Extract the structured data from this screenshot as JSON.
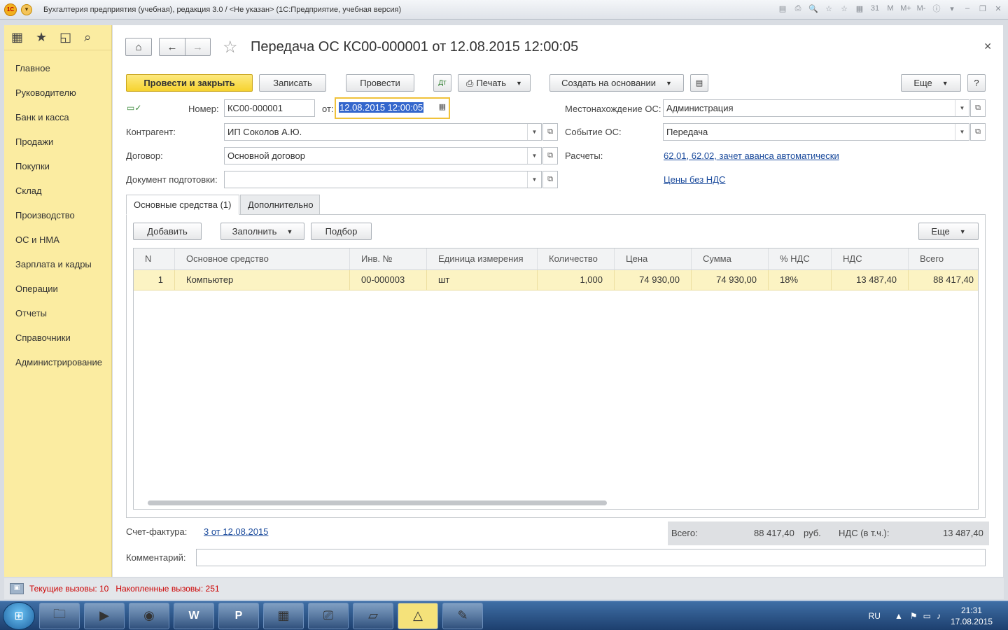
{
  "window": {
    "title": "Бухгалтерия предприятия (учебная), редакция 3.0 / <Не указан>  (1С:Предприятие, учебная версия)",
    "tool_icons": [
      "▤",
      "⎙",
      "🔍",
      "☆",
      "☆",
      "▦",
      "31",
      "M",
      "M+",
      "M-",
      "ⓘ",
      "▾"
    ],
    "controls": [
      "–",
      "❐",
      "✕"
    ]
  },
  "sidebar": {
    "items": [
      {
        "label": "Главное"
      },
      {
        "label": "Руководителю"
      },
      {
        "label": "Банк и касса"
      },
      {
        "label": "Продажи"
      },
      {
        "label": "Покупки"
      },
      {
        "label": "Склад"
      },
      {
        "label": "Производство"
      },
      {
        "label": "ОС и НМА"
      },
      {
        "label": "Зарплата и кадры"
      },
      {
        "label": "Операции"
      },
      {
        "label": "Отчеты"
      },
      {
        "label": "Справочники"
      },
      {
        "label": "Администрирование"
      }
    ]
  },
  "document": {
    "title": "Передача ОС КС00-000001 от 12.08.2015 12:00:05",
    "toolbar": {
      "post_close": "Провести и закрыть",
      "save": "Записать",
      "post": "Провести",
      "print": "Печать",
      "create_based": "Создать на основании",
      "more": "Еще",
      "help": "?"
    },
    "fields": {
      "number_label": "Номер:",
      "number_value": "КС00-000001",
      "date_label": "от:",
      "date_value": "12.08.2015 12:00:05",
      "location_label": "Местонахождение ОС:",
      "location_value": "Администрация",
      "counterparty_label": "Контрагент:",
      "counterparty_value": "ИП Соколов А.Ю.",
      "event_label": "Событие ОС:",
      "event_value": "Передача",
      "contract_label": "Договор:",
      "contract_value": "Основной договор",
      "settlements_label": "Расчеты:",
      "settlements_link": "62.01, 62.02, зачет аванса автоматически",
      "prep_doc_label": "Документ подготовки:",
      "prep_doc_value": "",
      "prices_link": "Цены без НДС"
    },
    "tabs": [
      {
        "label": "Основные средства (1)"
      },
      {
        "label": "Дополнительно"
      }
    ],
    "table_toolbar": {
      "add": "Добавить",
      "fill": "Заполнить",
      "select": "Подбор",
      "more": "Еще"
    },
    "table": {
      "columns": [
        "N",
        "Основное средство",
        "Инв. №",
        "Единица измерения",
        "Количество",
        "Цена",
        "Сумма",
        "% НДС",
        "НДС",
        "Всего"
      ],
      "rows": [
        [
          "1",
          "Компьютер",
          "00-000003",
          "шт",
          "1,000",
          "74 930,00",
          "74 930,00",
          "18%",
          "13 487,40",
          "88 417,40"
        ]
      ]
    },
    "footer": {
      "invoice_label": "Счет-фактура:",
      "invoice_link": "3 от 12.08.2015",
      "comment_label": "Комментарий:",
      "comment_value": "",
      "total_label": "Всего:",
      "total_value": "88 417,40",
      "currency": "руб.",
      "vat_label": "НДС (в т.ч.):",
      "vat_value": "13 487,40"
    }
  },
  "statusbar": {
    "current_calls": "Текущие вызовы: 10",
    "accumulated_calls": "Накопленные вызовы: 251"
  },
  "taskbar": {
    "lang": "RU",
    "time": "21:31",
    "date": "17.08.2015"
  }
}
